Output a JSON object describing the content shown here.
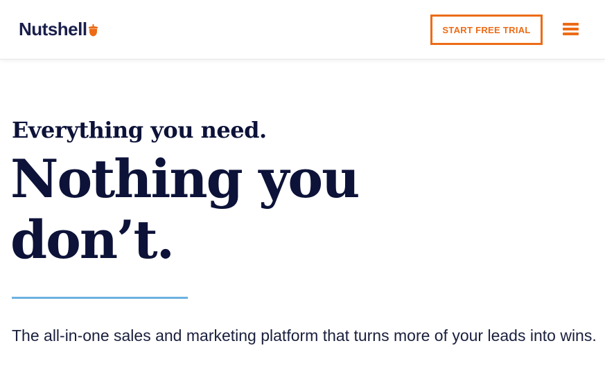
{
  "header": {
    "logo_text": "Nutshell",
    "logo_icon": "acorn-icon",
    "cta_label": "START FREE TRIAL",
    "menu_icon": "hamburger-menu-icon"
  },
  "hero": {
    "eyebrow": "Everything you need.",
    "headline": "Nothing you don’t.",
    "subtext": "The all-in-one sales and marketing platform that turns more of your leads into wins."
  },
  "colors": {
    "brand_orange": "#ec6b16",
    "navy": "#0c1238",
    "divider_blue": "#6cb1e0"
  }
}
